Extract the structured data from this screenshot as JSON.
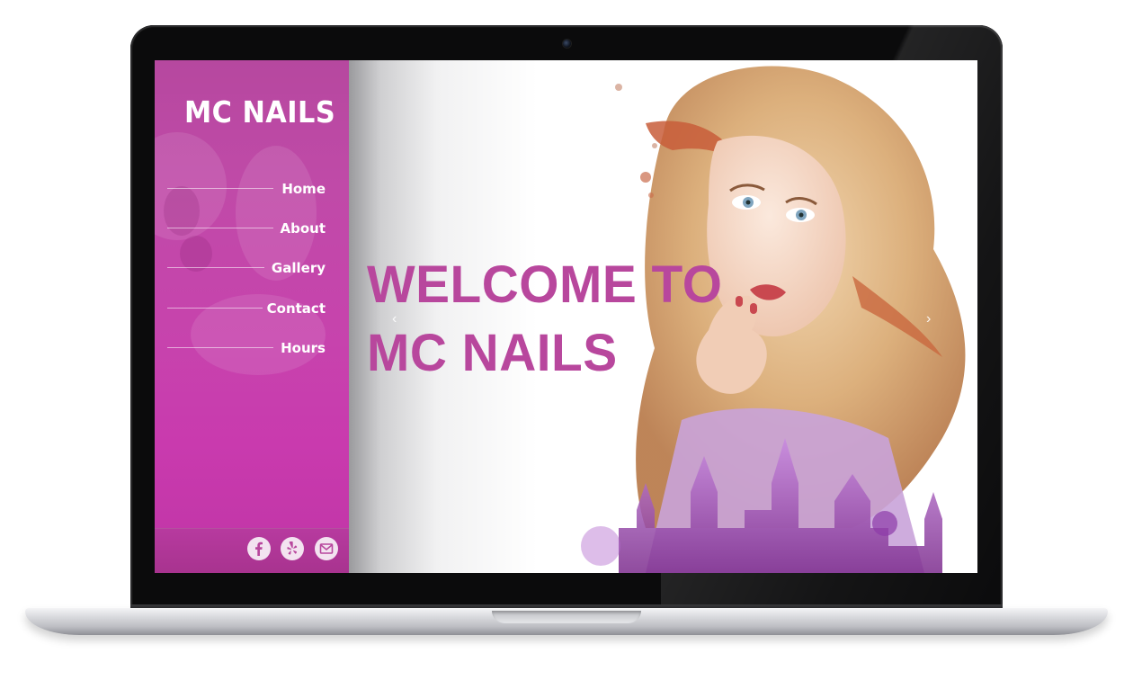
{
  "site": {
    "brand": "MC NAILS"
  },
  "nav": {
    "items": [
      {
        "label": "Home"
      },
      {
        "label": "About"
      },
      {
        "label": "Gallery"
      },
      {
        "label": "Contact"
      },
      {
        "label": "Hours"
      }
    ]
  },
  "hero": {
    "title_line1": "WELCOME TO",
    "title_line2": "MC NAILS",
    "prev_arrow": "‹",
    "next_arrow": "›"
  },
  "social": [
    {
      "icon": "facebook-icon"
    },
    {
      "icon": "yelp-icon"
    },
    {
      "icon": "email-icon"
    }
  ],
  "colors": {
    "sidebar": "#c743ad",
    "accent_text": "#b8479d",
    "nav_text": "#ffffff"
  }
}
